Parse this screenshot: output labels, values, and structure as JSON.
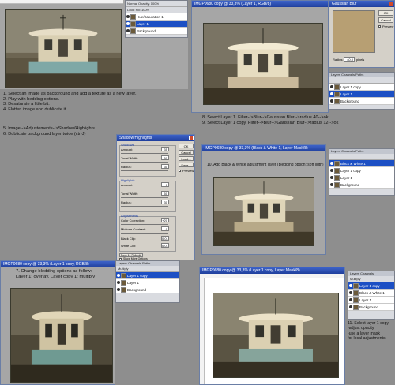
{
  "panel1": {
    "menu_row": "Normal    Opacity: 100%",
    "lock_row": "Lock:       Fill: 100%",
    "layers": [
      "Hue/Saturation 1",
      "Layer 1",
      "Background"
    ]
  },
  "panel2": {
    "doc_title": "IMGP0680 copy @ 33,3% (Layer 1, RGB/8)",
    "dialog_title": "Gaussian Blur",
    "ok": "OK",
    "cancel": "Cancel",
    "preview": "Preview",
    "radius_label": "Radius:",
    "radius_value": "40,0",
    "radius_unit": "pixels",
    "layers": [
      "Layer 1 copy",
      "Layer 1",
      "Background"
    ]
  },
  "steps_1_4": [
    "1. Select an image as background and add a texture as a new layer.",
    "2. Play with bedding options.",
    "3. Desaturate a little bit.",
    "4. Flatten image and dublicate it."
  ],
  "steps_8_9": [
    "8. Select Layer 1. Filter-->Blur-->Gaussian Blur-->radius 40-->ok",
    "9. Select Layer 1 copy. Filter-->Blur-->Gaussian Blur-->radius 12-->ok"
  ],
  "steps_5_6": [
    "5. Image-->Adjustements-->Shadow/Highlights",
    "6. Dublicate background layer twice (ctr-J)"
  ],
  "shadow_dialog": {
    "title": "Shadow/Highlights",
    "ok": "OK",
    "cancel": "Cancel",
    "load": "Load...",
    "save": "Save...",
    "preview": "Preview",
    "shadows": "Shadows",
    "highlights": "Highlights",
    "adjustments": "Adjustments",
    "amount": "Amount:",
    "tonal_width": "Tonal Width:",
    "radius": "Radius:",
    "color_correction": "Color Correction:",
    "midtone_contrast": "Midtone Contrast:",
    "black_clip": "Black Clip:",
    "white_clip": "White Clip:",
    "s_amount": "35",
    "s_tonal": "50",
    "s_radius": "30",
    "h_amount": "0",
    "h_tonal": "50",
    "h_radius": "30",
    "cc": "+20",
    "mc": "0",
    "bc": "0,01",
    "wc": "0,01",
    "save_defaults": "Save As Defaults",
    "show_more": "Show More Options"
  },
  "panel3": {
    "doc_title": "IMGP0680 copy @ 33,3% (Black & White 1, Layer Mask/8)",
    "note": "10. Add Black  & White adjustment layer (bledding option: soft ligth)",
    "layers": [
      "Black & White 1",
      "Layer 1 copy",
      "Layer 1",
      "Background"
    ]
  },
  "panel4": {
    "doc_title": "IMGP0680 copy @ 33,3% (Layer 1 copy, RGB/8)",
    "note_line1": "7. Change bledding options as follow:",
    "note_line2": "Layer 1: overlay, Layer copy 1: multiply",
    "blend": "Multiply",
    "layers": [
      "Layer 1 copy",
      "Layer 1",
      "Background"
    ]
  },
  "panel5": {
    "doc_title": "IMGP0680 copy @ 33,3% (Layer 1 copy, Layer Mask/8)",
    "blend": "Multiply",
    "notes": [
      "11. Select layer 1 copy",
      "-adjust opacity",
      "-use a layer mask",
      "for local adjustments"
    ],
    "layers": [
      "Layer 1 copy",
      "Black & White 1",
      "Layer 1",
      "Background"
    ]
  }
}
